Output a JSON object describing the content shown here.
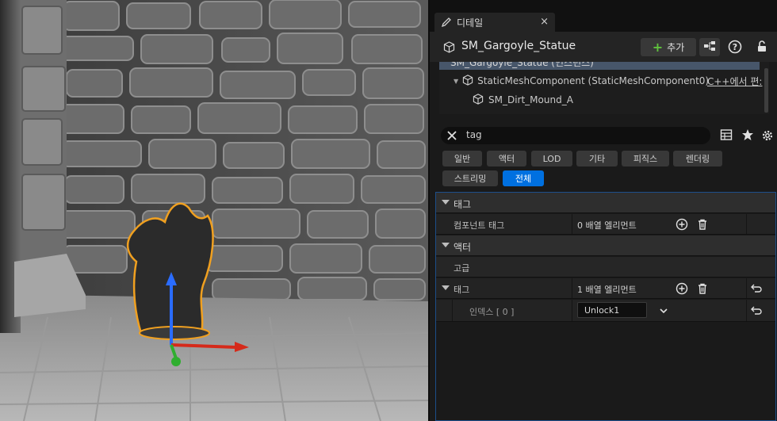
{
  "tab": {
    "label": "디테일",
    "close": "×"
  },
  "header": {
    "actor_name": "SM_Gargoyle_Statue",
    "add_label": "추가"
  },
  "tree": {
    "root_label": "SM_Gargoyle_Statue (인스턴스)",
    "component_label": "StaticMeshComponent (StaticMeshComponent0)",
    "cpp_label": "C++에서 편:",
    "child_label": "SM_Dirt_Mound_A"
  },
  "search": {
    "value": "tag"
  },
  "filters": [
    "일반",
    "액터",
    "LOD",
    "기타",
    "피직스",
    "렌더링",
    "스트리밍",
    "전체"
  ],
  "active_filter": "전체",
  "properties": {
    "cat_tags": "태그",
    "component_tags_label": "컴포넌트 태그",
    "component_tags_value": "0 배열 엘리먼트",
    "cat_actor": "액터",
    "cat_advanced": "고급",
    "tags_label": "태그",
    "tags_value": "1 배열 엘리먼트",
    "index_label": "인덱스 [ 0 ]",
    "index_value": "Unlock1"
  },
  "colors": {
    "accent": "#0070e0",
    "selection_outline": "#f0a020",
    "panel_bg": "#1a1a1a"
  }
}
